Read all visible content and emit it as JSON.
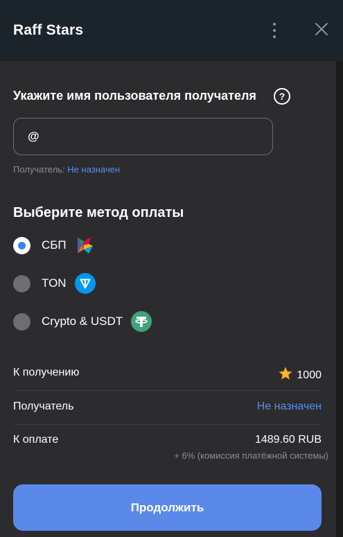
{
  "header": {
    "title": "Raff Stars",
    "menu_icon": "kebab-menu-icon",
    "close_icon": "close-icon"
  },
  "username": {
    "title": "Укажите имя пользователя получателя",
    "help_icon": "question-icon",
    "help_glyph": "?",
    "prefix": "@",
    "value": "",
    "recipient_label": "Получатель:",
    "recipient_value": "Не назначен"
  },
  "payment": {
    "title": "Выберите метод оплаты",
    "selected": "СБП",
    "methods": [
      {
        "label": "СБП",
        "icon": "sbp-logo-icon",
        "checked": true
      },
      {
        "label": "TON",
        "icon": "ton-logo-icon",
        "checked": false
      },
      {
        "label": "Crypto & USDT",
        "icon": "tether-logo-icon",
        "checked": false
      }
    ]
  },
  "summary": {
    "receive_label": "К получению",
    "receive_value": "1000",
    "receive_icon": "star-icon",
    "recipient_label": "Получатель",
    "recipient_value": "Не назначен",
    "pay_label": "К оплате",
    "pay_value": "1489.60 RUB",
    "fee_note": "+ 6% (комиссия платёжной системы)"
  },
  "actions": {
    "continue_label": "Продолжить"
  },
  "colors": {
    "accent": "#5a89ea",
    "link": "#5b8dee",
    "panel": "#2c2c2e",
    "header": "#1b232b"
  }
}
